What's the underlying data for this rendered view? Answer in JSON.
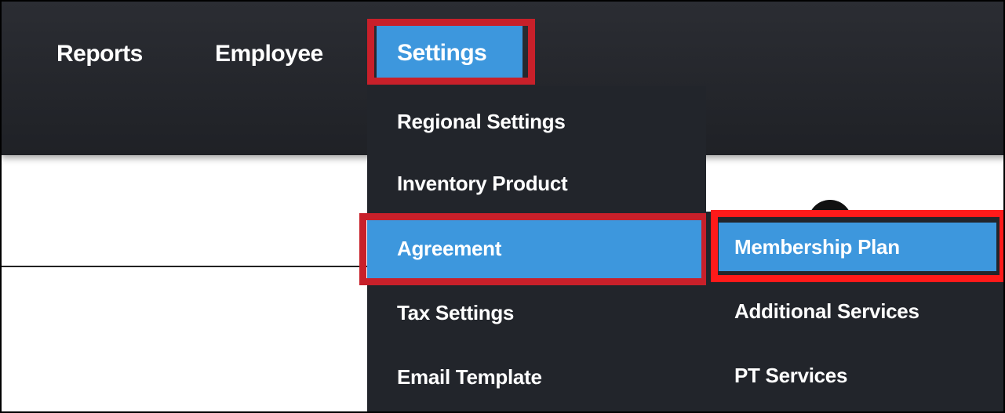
{
  "nav": {
    "items": [
      "Reports",
      "Employee",
      "Settings"
    ],
    "active": "Settings"
  },
  "settings_menu": {
    "items": [
      "Regional Settings",
      "Inventory Product",
      "Agreement",
      "Tax Settings",
      "Email Template"
    ],
    "active": "Agreement"
  },
  "agreement_submenu": {
    "items": [
      "Membership Plan",
      "Additional Services",
      "PT Services"
    ],
    "active": "Membership Plan"
  },
  "colors": {
    "navbar": "#26282d",
    "menu": "#22252b",
    "active": "#3d97dd",
    "highlight_box": "#c8202a",
    "highlight_box_bright": "#ff1a1a"
  }
}
